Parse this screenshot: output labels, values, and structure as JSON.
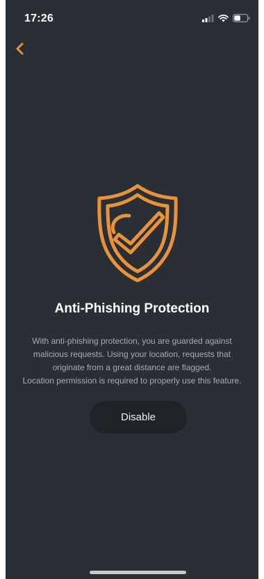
{
  "status_bar": {
    "time": "17:26",
    "icons": [
      "cellular-signal-icon",
      "wifi-icon",
      "battery-icon"
    ]
  },
  "nav": {
    "back_icon": "chevron-left-icon"
  },
  "hero_icon": "shield-check-icon",
  "title": "Anti-Phishing Protection",
  "description": {
    "line1": "With anti-phishing protection, you are guarded against",
    "line2": "malicious requests. Using your location, requests that",
    "line3": "originate from a great distance are flagged.",
    "line4": "Location permission is required to properly use this feature."
  },
  "disable_button_label": "Disable",
  "colors": {
    "background": "#2a2e35",
    "accent": "#e8923a",
    "button_bg": "#1f2227",
    "text_secondary": "#a8abb1"
  }
}
